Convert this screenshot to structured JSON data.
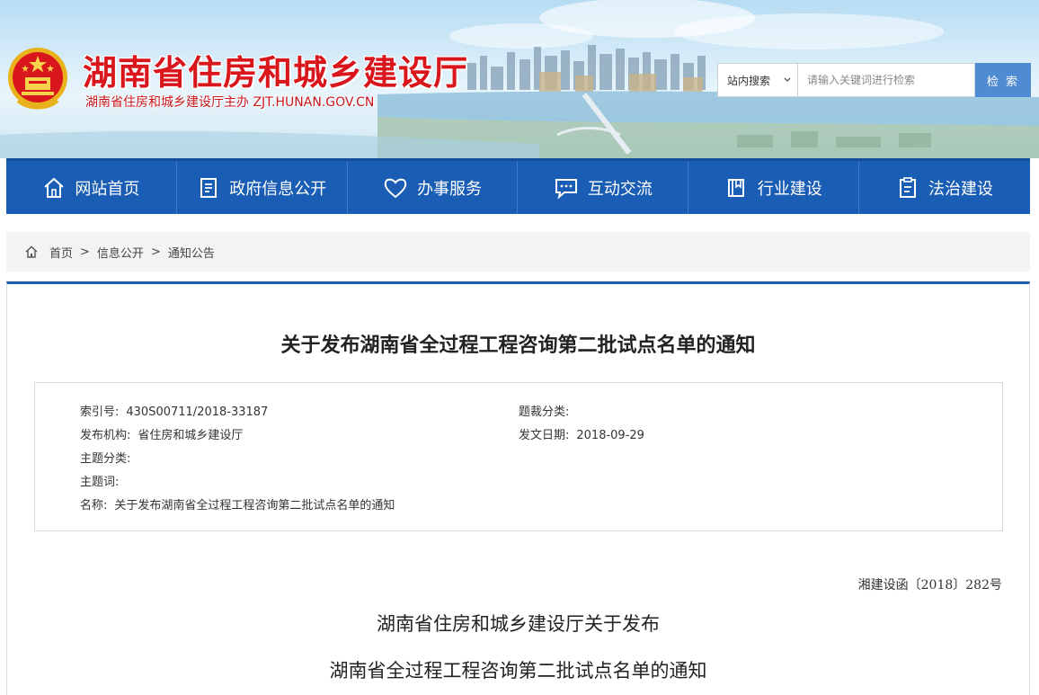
{
  "header": {
    "site_title": "湖南省住房和城乡建设厅",
    "site_subtitle": "湖南省住房和城乡建设厅主办  ZJT.HUNAN.GOV.CN",
    "emblem": "national-emblem",
    "search": {
      "scope_value": "站内搜索",
      "placeholder": "请输入关键词进行检索",
      "button_label": "检 索"
    }
  },
  "nav": {
    "items": [
      {
        "label": "网站首页",
        "icon": "home-icon"
      },
      {
        "label": "政府信息公开",
        "icon": "document-icon"
      },
      {
        "label": "办事服务",
        "icon": "heart-icon"
      },
      {
        "label": "互动交流",
        "icon": "chat-icon"
      },
      {
        "label": "行业建设",
        "icon": "book-icon"
      },
      {
        "label": "法治建设",
        "icon": "clipboard-icon"
      }
    ]
  },
  "breadcrumb": {
    "items": [
      "首页",
      "信息公开",
      "通知公告"
    ],
    "separator": ">"
  },
  "article": {
    "title": "关于发布湖南省全过程工程咨询第二批试点名单的通知",
    "meta": {
      "index_label": "索引号:",
      "index_value": "430S00711/2018-33187",
      "genre_label": "题裁分类:",
      "genre_value": "",
      "publisher_label": "发布机构:",
      "publisher_value": "省住房和城乡建设厅",
      "date_label": "发文日期:",
      "date_value": "2018-09-29",
      "topic_label": "主题分类:",
      "topic_value": "",
      "keywords_label": "主题词:",
      "keywords_value": "",
      "name_label": "名称:",
      "name_value": "关于发布湖南省全过程工程咨询第二批试点名单的通知"
    },
    "doc_number": "湘建设函〔2018〕282号",
    "heading_line1": "湖南省住房和城乡建设厅关于发布",
    "heading_line2": "湖南省全过程工程咨询第二批试点名单的通知"
  },
  "colors": {
    "nav_blue": "#1a5db4",
    "title_red": "#d8161c",
    "search_button": "#4f8bd2"
  }
}
